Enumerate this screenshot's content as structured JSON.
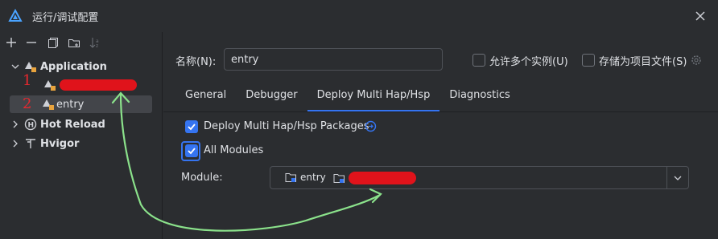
{
  "window": {
    "title": "运行/调试配置"
  },
  "toolbar": {
    "icons": [
      "add-icon",
      "remove-icon",
      "copy-icon",
      "folder-add-icon",
      "sort-icon"
    ]
  },
  "tree": {
    "application": {
      "label": "Application"
    },
    "child1": {
      "marker": "1",
      "label_redacted": true
    },
    "child2": {
      "marker": "2",
      "label": "entry"
    },
    "hot_reload": {
      "label": "Hot Reload"
    },
    "hvigor": {
      "label": "Hvigor"
    }
  },
  "form": {
    "name_label": "名称(N):",
    "name_value": "entry",
    "allow_multiple_label": "允许多个实例(U)",
    "store_as_file_label": "存储为项目文件(S)"
  },
  "tabs": [
    {
      "label": "General"
    },
    {
      "label": "Debugger"
    },
    {
      "label": "Deploy Multi Hap/Hsp"
    },
    {
      "label": "Diagnostics"
    }
  ],
  "deploy": {
    "packages_label": "Deploy Multi Hap/Hsp Packages",
    "all_modules_label": "All Modules",
    "module_label": "Module:",
    "module_items": [
      {
        "label": "entry"
      },
      {
        "label_redacted": true
      }
    ]
  },
  "colors": {
    "background": "#2b2d30",
    "accent": "#3574f0",
    "redaction": "#e0131b",
    "annotation_arrow": "#8be28b"
  }
}
